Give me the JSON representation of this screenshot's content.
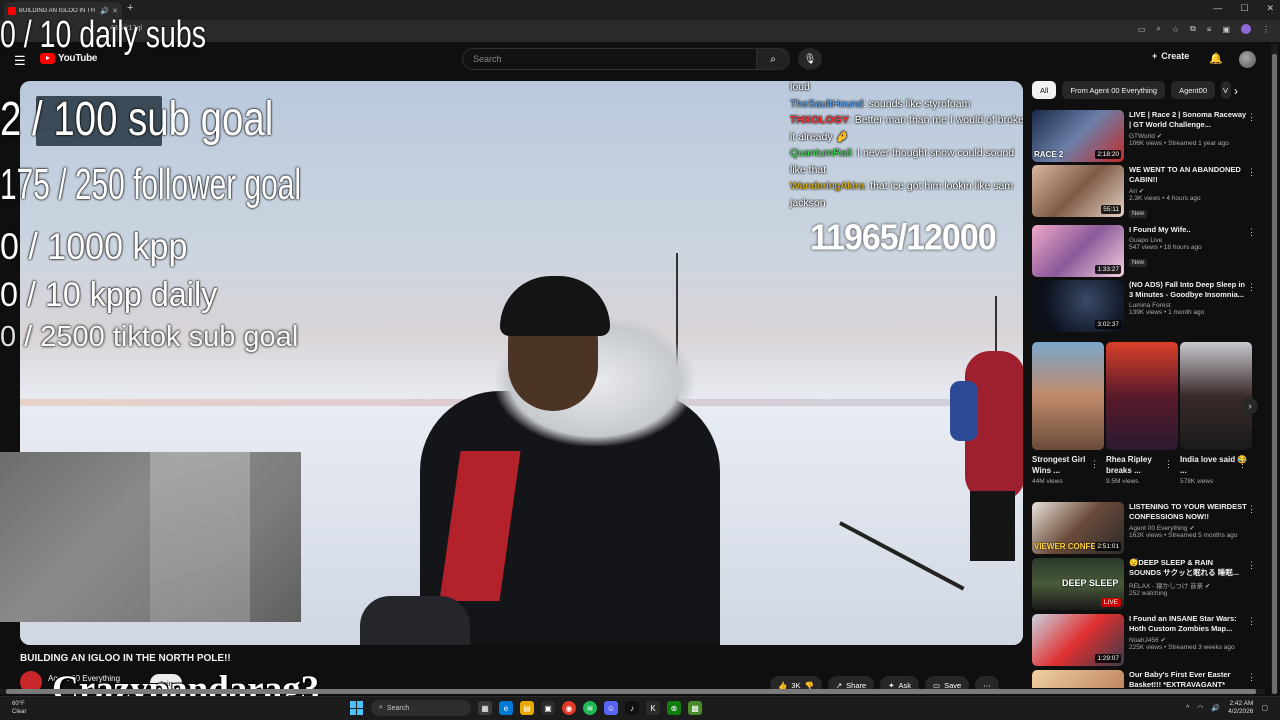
{
  "browser": {
    "tab_title": "BUILDING AN IGLOO IN TH",
    "url": "481kk17ql"
  },
  "youtube": {
    "logo_text": "YouTube",
    "search_placeholder": "Search",
    "create_label": "Create"
  },
  "overlay": {
    "daily_subs": "0 / 10 daily subs",
    "sub_goal": "2  / 100 sub goal",
    "follower_goal": "175 / 250 follower goal",
    "kpp": "0 / 1000 kpp",
    "kpp_daily": "0 / 10 kpp daily",
    "tiktok_goal": "0 / 2500 tiktok sub goal",
    "counter": "11965/12000",
    "watermark": "Crazypandarag3"
  },
  "chat": {
    "messages": [
      {
        "user": "",
        "text": "loud"
      },
      {
        "user": "TheSaultHound",
        "text": ": sounds like styrofoam"
      },
      {
        "user": "THXOLOGY",
        "text": ": Better man than me I would of broke it already 🤌"
      },
      {
        "user": "QuantumRail",
        "text": ": I never thought snow could sound like that"
      },
      {
        "user": "WanderingAkira",
        "text": ": that ice got him lookin like sam jackson"
      }
    ]
  },
  "video": {
    "title": "BUILDING AN IGLOO IN THE NORTH POLE!!",
    "channel": "Agent 00 Everything",
    "join_label": "Join",
    "likes": "3K",
    "share_label": "Share",
    "ask_label": "Ask",
    "save_label": "Save"
  },
  "sidebar": {
    "chips": [
      "All",
      "From Agent 00 Everything",
      "Agent00",
      "V"
    ],
    "recs_top": [
      {
        "title": "LIVE | Race 2 | Sonoma Raceway | GT World Challenge...",
        "channel": "GTWorld ✔",
        "meta": "106K views • Streamed 1 year ago",
        "duration": "2:18:20",
        "overlay": "RACE 2",
        "new": ""
      },
      {
        "title": "WE WENT TO AN ABANDONED CABIN!!",
        "channel": "Ari ✔",
        "meta": "2.3K views • 4 hours ago",
        "duration": "55:11",
        "overlay": "",
        "new": "New"
      },
      {
        "title": "I Found My Wife..",
        "channel": "Guapo Live",
        "meta": "547 views • 18 hours ago",
        "duration": "1:33:27",
        "overlay": "",
        "new": "New"
      },
      {
        "title": "(NO ADS) Fall Into Deep Sleep in 3 Minutes - Goodbye Insomnia...",
        "channel": "Lumina Forest",
        "meta": "139K views • 1 month ago",
        "duration": "3:02:37",
        "overlay": "",
        "new": ""
      }
    ],
    "shorts": [
      {
        "title": "Strongest Girl Wins ...",
        "views": "44M views"
      },
      {
        "title": "Rhea Ripley breaks ...",
        "views": "9.5M views"
      },
      {
        "title": "India love said 😂 ...",
        "views": "578K views"
      }
    ],
    "recs_bottom": [
      {
        "title": "LISTENING TO YOUR WEIRDEST CONFESSIONS NOW!!",
        "channel": "Agent 00 Everything ✔",
        "meta": "162K views • Streamed 5 months ago",
        "duration": "2:51:01",
        "overlay": "VIEWER CONFESS",
        "live": ""
      },
      {
        "title": "😴DEEP SLEEP & RAIN SOUNDS サクッと眠れる 睡眠...",
        "channel": "RELAX - 寝かしつけ 音楽 ✔",
        "meta": "252 watching",
        "duration": "",
        "overlay": "DEEP SLEEP",
        "live": "LIVE"
      },
      {
        "title": "I Found an INSANE Star Wars: Hoth Custom Zombies Map...",
        "channel": "NoahJ456 ✔",
        "meta": "225K views • Streamed 3 weeks ago",
        "duration": "1:29:07",
        "overlay": "",
        "live": ""
      },
      {
        "title": "Our Baby's First Ever Easter Basket!!! *EXTRAVAGANT*",
        "channel": "",
        "meta": "",
        "duration": "",
        "overlay": "",
        "live": ""
      }
    ]
  },
  "taskbar": {
    "weather_temp": "60°F",
    "weather_desc": "Clear",
    "search_label": "Search",
    "time": "2:42 AM",
    "date": "4/2/2026"
  }
}
